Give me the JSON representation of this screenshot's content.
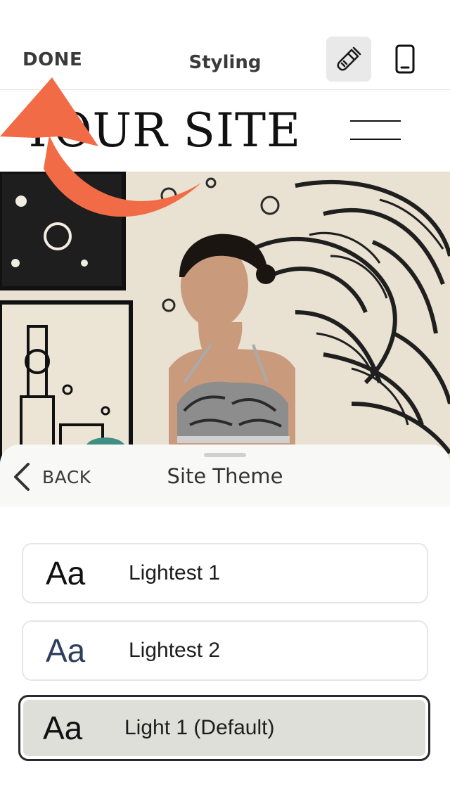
{
  "toolbar": {
    "done_label": "DONE",
    "title": "Styling",
    "brush_icon": "paintbrush-icon",
    "phone_icon": "mobile-preview-icon"
  },
  "site_header": {
    "logo_text": "YOUR SITE",
    "menu_icon": "hamburger-menu-icon"
  },
  "hero": {
    "description_icon": "hero-photo"
  },
  "overlay": {
    "arrow_color": "#F26B47"
  },
  "sheet": {
    "back_label": "BACK",
    "title": "Site Theme",
    "themes": [
      {
        "sample": "Aa",
        "label": "Lightest 1",
        "sample_color": "#111111",
        "selected": false
      },
      {
        "sample": "Aa",
        "label": "Lightest 2",
        "sample_color": "#2E3F5E",
        "selected": false
      },
      {
        "sample": "Aa",
        "label": "Light 1 (Default)",
        "sample_color": "#111111",
        "selected": true
      }
    ]
  }
}
